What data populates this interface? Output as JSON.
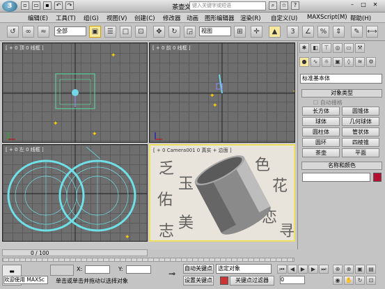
{
  "titlebar": {
    "logo": "3",
    "title": "茶壶文件.max",
    "search_placeholder": "键入关键字或短语"
  },
  "menu": [
    "编辑(E)",
    "工具(T)",
    "组(G)",
    "视图(V)",
    "创建(C)",
    "修改器",
    "动画",
    "图形编辑器",
    "渲染(R)",
    "自定义(U)",
    "MAXScript(M)",
    "帮助(H)"
  ],
  "toolbar": {
    "selection_filter": "全部",
    "ref_coord": "视图"
  },
  "viewports": {
    "top": "[ + 0 顶 0 线框 ]",
    "front": "[ + 0 前 0 线框 ]",
    "left": "[ + 0 左 0 线框 ]",
    "camera": "[ + 0 Camera001 0 真实 + 边面 ]"
  },
  "panel": {
    "category": "标准基本体",
    "object_type": "对象类型",
    "autogrid": "自动栅格",
    "buttons": [
      [
        "长方体",
        "圆锥体"
      ],
      [
        "球体",
        "几何球体"
      ],
      [
        "圆柱体",
        "管状体"
      ],
      [
        "圆环",
        "四棱锥"
      ],
      [
        "茶壶",
        "平面"
      ]
    ],
    "name_color": "名称和颜色",
    "name_color_swatch": "#b81030"
  },
  "status": {
    "timeslider": "0 / 100",
    "welcome": "欢迎使用 MAXSc",
    "prompt": "单击或单击并拖动以选择对象",
    "x_label": "X:",
    "y_label": "Y:",
    "auto_key": "自动关键点",
    "set_key": "设置关键点",
    "selected": "选定对象",
    "key_filters": "关键点过滤器",
    "frame": "0"
  }
}
